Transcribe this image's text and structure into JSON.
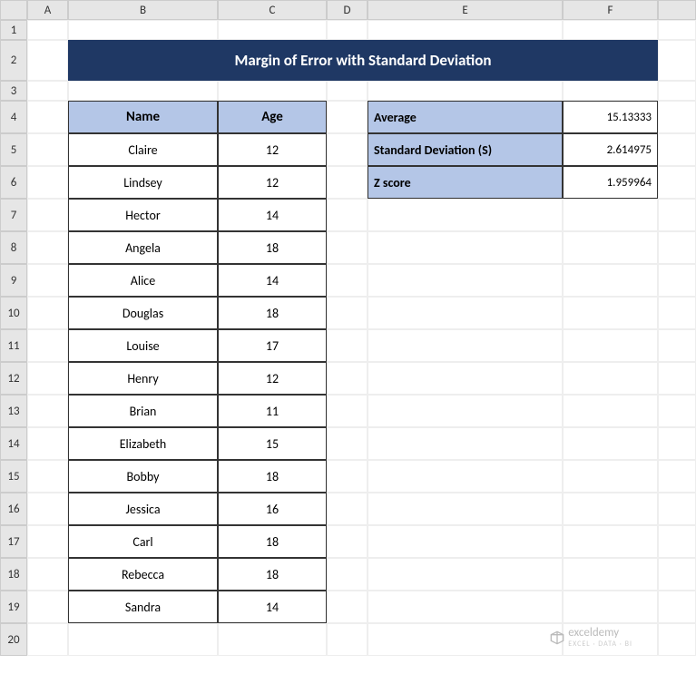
{
  "columns": [
    "A",
    "B",
    "C",
    "D",
    "E",
    "F",
    ""
  ],
  "rows": [
    "1",
    "2",
    "3",
    "4",
    "5",
    "6",
    "7",
    "8",
    "9",
    "10",
    "11",
    "12",
    "13",
    "14",
    "15",
    "16",
    "17",
    "18",
    "19",
    "20"
  ],
  "title": "Margin of Error with Standard Deviation",
  "table": {
    "headers": {
      "name": "Name",
      "age": "Age"
    },
    "data": [
      {
        "name": "Claire",
        "age": "12"
      },
      {
        "name": "Lindsey",
        "age": "12"
      },
      {
        "name": "Hector",
        "age": "14"
      },
      {
        "name": "Angela",
        "age": "18"
      },
      {
        "name": "Alice",
        "age": "14"
      },
      {
        "name": "Douglas",
        "age": "18"
      },
      {
        "name": "Louise",
        "age": "17"
      },
      {
        "name": "Henry",
        "age": "12"
      },
      {
        "name": "Brian",
        "age": "11"
      },
      {
        "name": "Elizabeth",
        "age": "15"
      },
      {
        "name": "Bobby",
        "age": "18"
      },
      {
        "name": "Jessica",
        "age": "16"
      },
      {
        "name": "Carl",
        "age": "18"
      },
      {
        "name": "Rebecca",
        "age": "18"
      },
      {
        "name": "Sandra",
        "age": "14"
      }
    ]
  },
  "stats": [
    {
      "label": "Average",
      "value": "15.13333"
    },
    {
      "label": "Standard Deviation (S)",
      "value": "2.614975"
    },
    {
      "label": "Z score",
      "value": "1.959964"
    }
  ],
  "watermark": {
    "text": "exceldemy",
    "subtext": "EXCEL · DATA · BI"
  }
}
